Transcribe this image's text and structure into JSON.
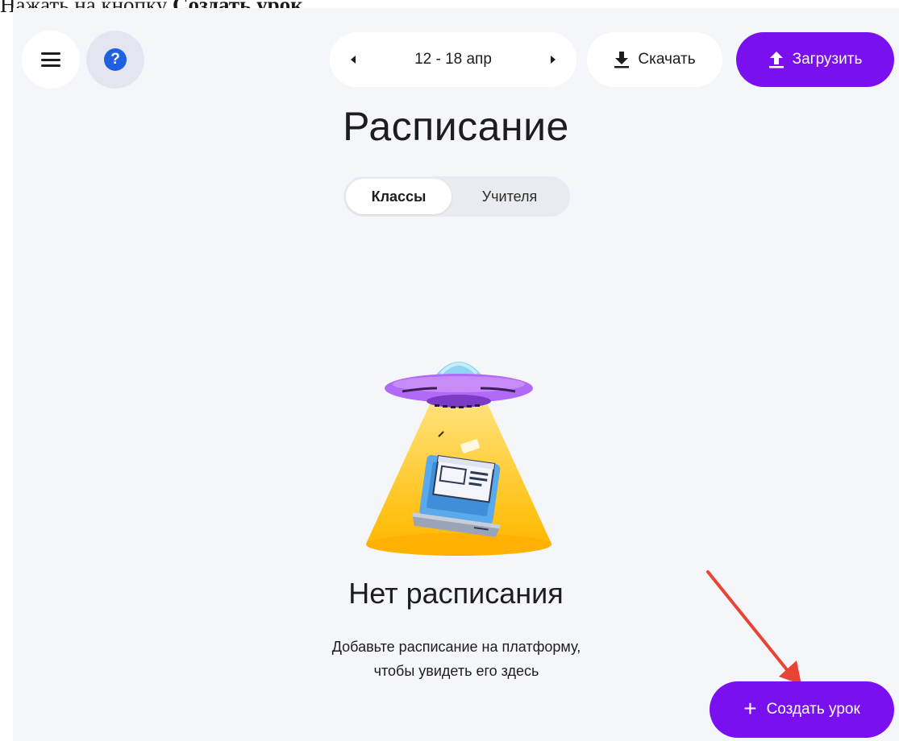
{
  "caption": {
    "prefix": "Нажать на кнопку ",
    "bold": "Создать урок."
  },
  "header": {
    "menu_icon": "hamburger-menu-icon",
    "help_icon": "question-circle-icon",
    "help_glyph": "?",
    "week_range": "12 - 18 апр",
    "download_label": "Скачать",
    "upload_label": "Загрузить"
  },
  "page": {
    "title": "Расписание"
  },
  "tabs": {
    "items": [
      {
        "label": "Классы",
        "active": true
      },
      {
        "label": "Учителя",
        "active": false
      }
    ]
  },
  "empty_state": {
    "illustration": "ufo-laptop-illustration",
    "title": "Нет расписания",
    "line1": "Добавьте расписание на платформу,",
    "line2": "чтобы увидеть его здесь"
  },
  "actions": {
    "create_label": "Создать урок",
    "create_icon": "+"
  },
  "colors": {
    "accent": "#7a0ff0",
    "background": "#f5f6f9",
    "help_icon": "#1f5fe0",
    "annotation_arrow": "#e84333"
  }
}
